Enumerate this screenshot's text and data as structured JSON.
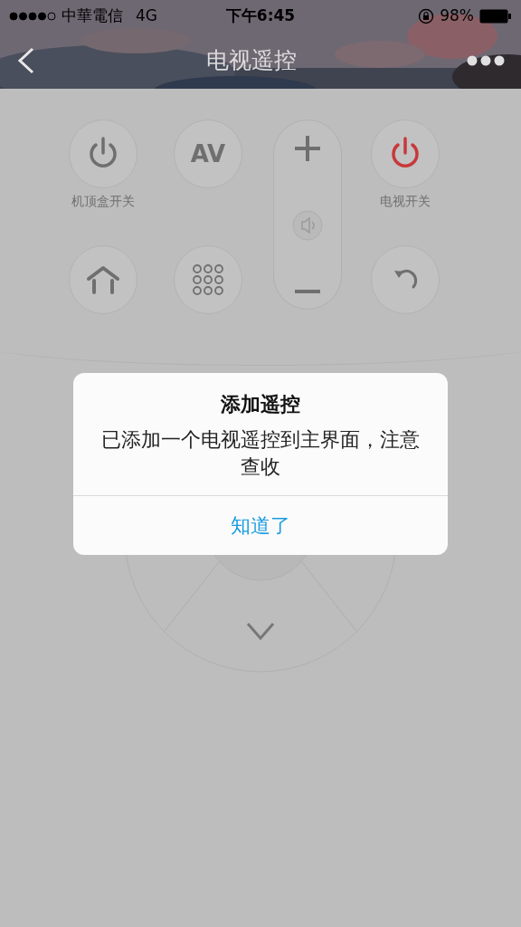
{
  "status_bar": {
    "carrier": "中華電信",
    "network": "4G",
    "time": "下午6:45",
    "battery": "98%"
  },
  "nav_bar": {
    "title": "电视遥控"
  },
  "remote_buttons": [
    {
      "kind": "power",
      "label": "机顶盒开关"
    },
    {
      "kind": "av",
      "text": "AV"
    },
    {
      "kind": "tv_power",
      "label": "电视开关"
    },
    {
      "kind": "home"
    },
    {
      "kind": "keypad"
    },
    {
      "kind": "back"
    }
  ],
  "dialog": {
    "title": "添加遥控",
    "message": "已添加一个电视遥控到主界面，注意查收",
    "button": "知道了"
  }
}
